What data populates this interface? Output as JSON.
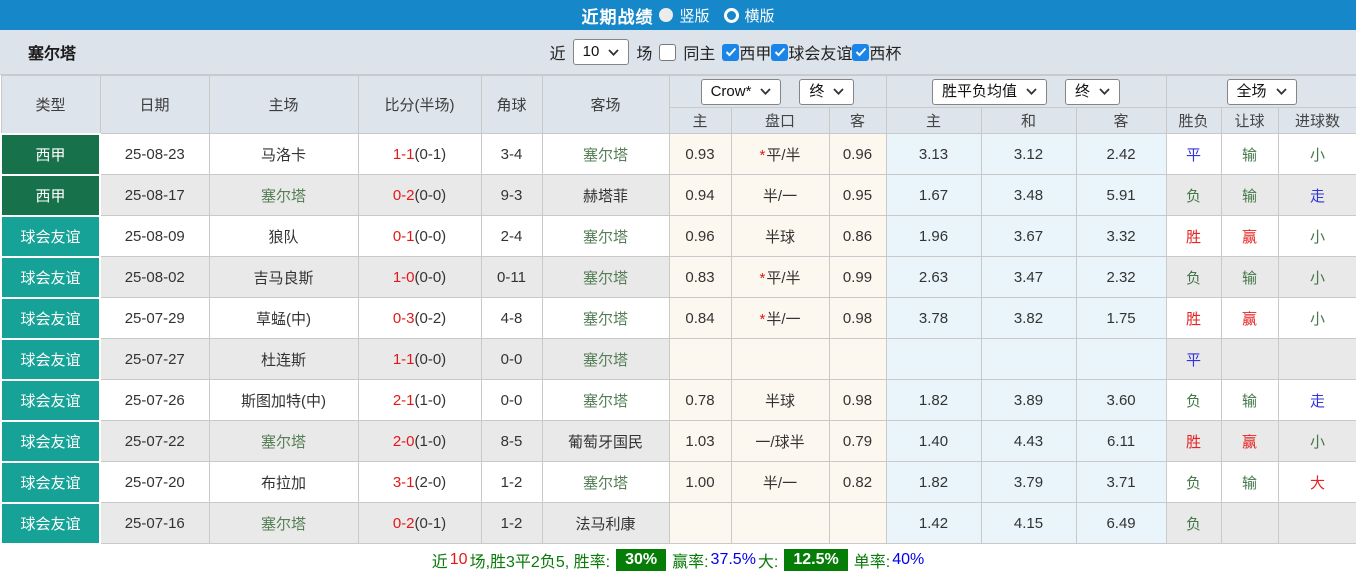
{
  "colors": {
    "topbar_blue": "#1688c9",
    "liga_green": "#17714a",
    "friendly_teal": "#16a296",
    "checkbox_blue": "#1a85e8",
    "score_red": "#e61717",
    "team_green": "#567f57",
    "result_red": "#e62222",
    "result_green": "#44784a",
    "result_blue": "#3333dd",
    "badge_green": "#067d06",
    "odds_cream": "#fdf8ef",
    "avg_lightblue": "#e9f4fb"
  },
  "topbar": {
    "title": "近期战绩",
    "options": [
      {
        "label": "竖版",
        "selected": true
      },
      {
        "label": "横版",
        "selected": false
      }
    ]
  },
  "filter": {
    "team": "塞尔塔",
    "near_label": "近",
    "count_value": "10",
    "games_label": "场",
    "same_home_label": "同主",
    "same_home_checked": false,
    "leagues": [
      {
        "label": "西甲",
        "checked": true
      },
      {
        "label": "球会友谊",
        "checked": true
      },
      {
        "label": "西杯",
        "checked": true
      }
    ]
  },
  "table": {
    "main_headers": [
      "类型",
      "日期",
      "主场",
      "比分(半场)",
      "角球",
      "客场"
    ],
    "dropdowns": {
      "company": "Crow*",
      "company_period": "终",
      "avg": "胜平负均值",
      "avg_period": "终",
      "scope": "全场"
    },
    "sub_headers": {
      "crow": [
        "主",
        "盘口",
        "客"
      ],
      "avg": [
        "主",
        "和",
        "客"
      ],
      "result": [
        "胜负",
        "让球",
        "进球数"
      ]
    },
    "rows": [
      {
        "type": "西甲",
        "type_style": "liga",
        "date": "25-08-23",
        "home": {
          "name": "马洛卡",
          "highlight": false
        },
        "score": "1-1",
        "half": "(0-1)",
        "corner": "3-4",
        "away": {
          "name": "塞尔塔",
          "highlight": true
        },
        "odds": {
          "home": "0.93",
          "star": true,
          "handicap": "平/半",
          "away": "0.96"
        },
        "avg": [
          "3.13",
          "3.12",
          "2.42"
        ],
        "results": [
          {
            "text": "平",
            "color": "blue"
          },
          {
            "text": "输",
            "color": "green"
          },
          {
            "text": "小",
            "color": "green"
          }
        ]
      },
      {
        "type": "西甲",
        "type_style": "liga",
        "date": "25-08-17",
        "home": {
          "name": "塞尔塔",
          "highlight": true
        },
        "score": "0-2",
        "half": "(0-0)",
        "corner": "9-3",
        "away": {
          "name": "赫塔菲",
          "highlight": false
        },
        "odds": {
          "home": "0.94",
          "star": false,
          "handicap": "半/一",
          "away": "0.95"
        },
        "avg": [
          "1.67",
          "3.48",
          "5.91"
        ],
        "results": [
          {
            "text": "负",
            "color": "green"
          },
          {
            "text": "输",
            "color": "green"
          },
          {
            "text": "走",
            "color": "blue"
          }
        ]
      },
      {
        "type": "球会友谊",
        "type_style": "friendly",
        "date": "25-08-09",
        "home": {
          "name": "狼队",
          "highlight": false
        },
        "score": "0-1",
        "half": "(0-0)",
        "corner": "2-4",
        "away": {
          "name": "塞尔塔",
          "highlight": true
        },
        "odds": {
          "home": "0.96",
          "star": false,
          "handicap": "半球",
          "away": "0.86"
        },
        "avg": [
          "1.96",
          "3.67",
          "3.32"
        ],
        "results": [
          {
            "text": "胜",
            "color": "red"
          },
          {
            "text": "赢",
            "color": "red"
          },
          {
            "text": "小",
            "color": "green"
          }
        ]
      },
      {
        "type": "球会友谊",
        "type_style": "friendly",
        "date": "25-08-02",
        "home": {
          "name": "吉马良斯",
          "highlight": false
        },
        "score": "1-0",
        "half": "(0-0)",
        "corner": "0-11",
        "away": {
          "name": "塞尔塔",
          "highlight": true
        },
        "odds": {
          "home": "0.83",
          "star": true,
          "handicap": "平/半",
          "away": "0.99"
        },
        "avg": [
          "2.63",
          "3.47",
          "2.32"
        ],
        "results": [
          {
            "text": "负",
            "color": "green"
          },
          {
            "text": "输",
            "color": "green"
          },
          {
            "text": "小",
            "color": "green"
          }
        ]
      },
      {
        "type": "球会友谊",
        "type_style": "friendly",
        "date": "25-07-29",
        "home": {
          "name": "草蜢(中)",
          "highlight": false
        },
        "score": "0-3",
        "half": "(0-2)",
        "corner": "4-8",
        "away": {
          "name": "塞尔塔",
          "highlight": true
        },
        "odds": {
          "home": "0.84",
          "star": true,
          "handicap": "半/一",
          "away": "0.98"
        },
        "avg": [
          "3.78",
          "3.82",
          "1.75"
        ],
        "results": [
          {
            "text": "胜",
            "color": "red"
          },
          {
            "text": "赢",
            "color": "red"
          },
          {
            "text": "小",
            "color": "green"
          }
        ]
      },
      {
        "type": "球会友谊",
        "type_style": "friendly",
        "date": "25-07-27",
        "home": {
          "name": "杜连斯",
          "highlight": false
        },
        "score": "1-1",
        "half": "(0-0)",
        "corner": "0-0",
        "away": {
          "name": "塞尔塔",
          "highlight": true
        },
        "odds": {
          "home": "",
          "star": false,
          "handicap": "",
          "away": ""
        },
        "avg": [
          "",
          "",
          ""
        ],
        "results": [
          {
            "text": "平",
            "color": "blue"
          },
          {
            "text": "",
            "color": ""
          },
          {
            "text": "",
            "color": ""
          }
        ]
      },
      {
        "type": "球会友谊",
        "type_style": "friendly",
        "date": "25-07-26",
        "home": {
          "name": "斯图加特(中)",
          "highlight": false
        },
        "score": "2-1",
        "half": "(1-0)",
        "corner": "0-0",
        "away": {
          "name": "塞尔塔",
          "highlight": true
        },
        "odds": {
          "home": "0.78",
          "star": false,
          "handicap": "半球",
          "away": "0.98"
        },
        "avg": [
          "1.82",
          "3.89",
          "3.60"
        ],
        "results": [
          {
            "text": "负",
            "color": "green"
          },
          {
            "text": "输",
            "color": "green"
          },
          {
            "text": "走",
            "color": "blue"
          }
        ]
      },
      {
        "type": "球会友谊",
        "type_style": "friendly",
        "date": "25-07-22",
        "home": {
          "name": "塞尔塔",
          "highlight": true
        },
        "score": "2-0",
        "half": "(1-0)",
        "corner": "8-5",
        "away": {
          "name": "葡萄牙国民",
          "highlight": false
        },
        "odds": {
          "home": "1.03",
          "star": false,
          "handicap": "一/球半",
          "away": "0.79"
        },
        "avg": [
          "1.40",
          "4.43",
          "6.11"
        ],
        "results": [
          {
            "text": "胜",
            "color": "red"
          },
          {
            "text": "赢",
            "color": "red"
          },
          {
            "text": "小",
            "color": "green"
          }
        ]
      },
      {
        "type": "球会友谊",
        "type_style": "friendly",
        "date": "25-07-20",
        "home": {
          "name": "布拉加",
          "highlight": false
        },
        "score": "3-1",
        "half": "(2-0)",
        "corner": "1-2",
        "away": {
          "name": "塞尔塔",
          "highlight": true
        },
        "odds": {
          "home": "1.00",
          "star": false,
          "handicap": "半/一",
          "away": "0.82"
        },
        "avg": [
          "1.82",
          "3.79",
          "3.71"
        ],
        "results": [
          {
            "text": "负",
            "color": "green"
          },
          {
            "text": "输",
            "color": "green"
          },
          {
            "text": "大",
            "color": "red"
          }
        ]
      },
      {
        "type": "球会友谊",
        "type_style": "friendly",
        "date": "25-07-16",
        "home": {
          "name": "塞尔塔",
          "highlight": true
        },
        "score": "0-2",
        "half": "(0-1)",
        "corner": "1-2",
        "away": {
          "name": "法马利康",
          "highlight": false
        },
        "odds": {
          "home": "",
          "star": false,
          "handicap": "",
          "away": ""
        },
        "avg": [
          "1.42",
          "4.15",
          "6.49"
        ],
        "results": [
          {
            "text": "负",
            "color": "green"
          },
          {
            "text": "",
            "color": ""
          },
          {
            "text": "",
            "color": ""
          }
        ]
      }
    ]
  },
  "summary": {
    "segments": [
      {
        "text": "近",
        "color": "green"
      },
      {
        "text": "10",
        "color": "red"
      },
      {
        "text": "场,胜3平2负5, 胜率:",
        "color": "green"
      },
      {
        "text": "30%",
        "badge": true
      },
      {
        "text": "赢率:",
        "color": "green"
      },
      {
        "text": "37.5%",
        "color": "blue"
      },
      {
        "text": " 大:",
        "color": "green"
      },
      {
        "text": "12.5%",
        "badge": true
      },
      {
        "text": "单率:",
        "color": "green"
      },
      {
        "text": "40%",
        "color": "blue"
      }
    ]
  }
}
